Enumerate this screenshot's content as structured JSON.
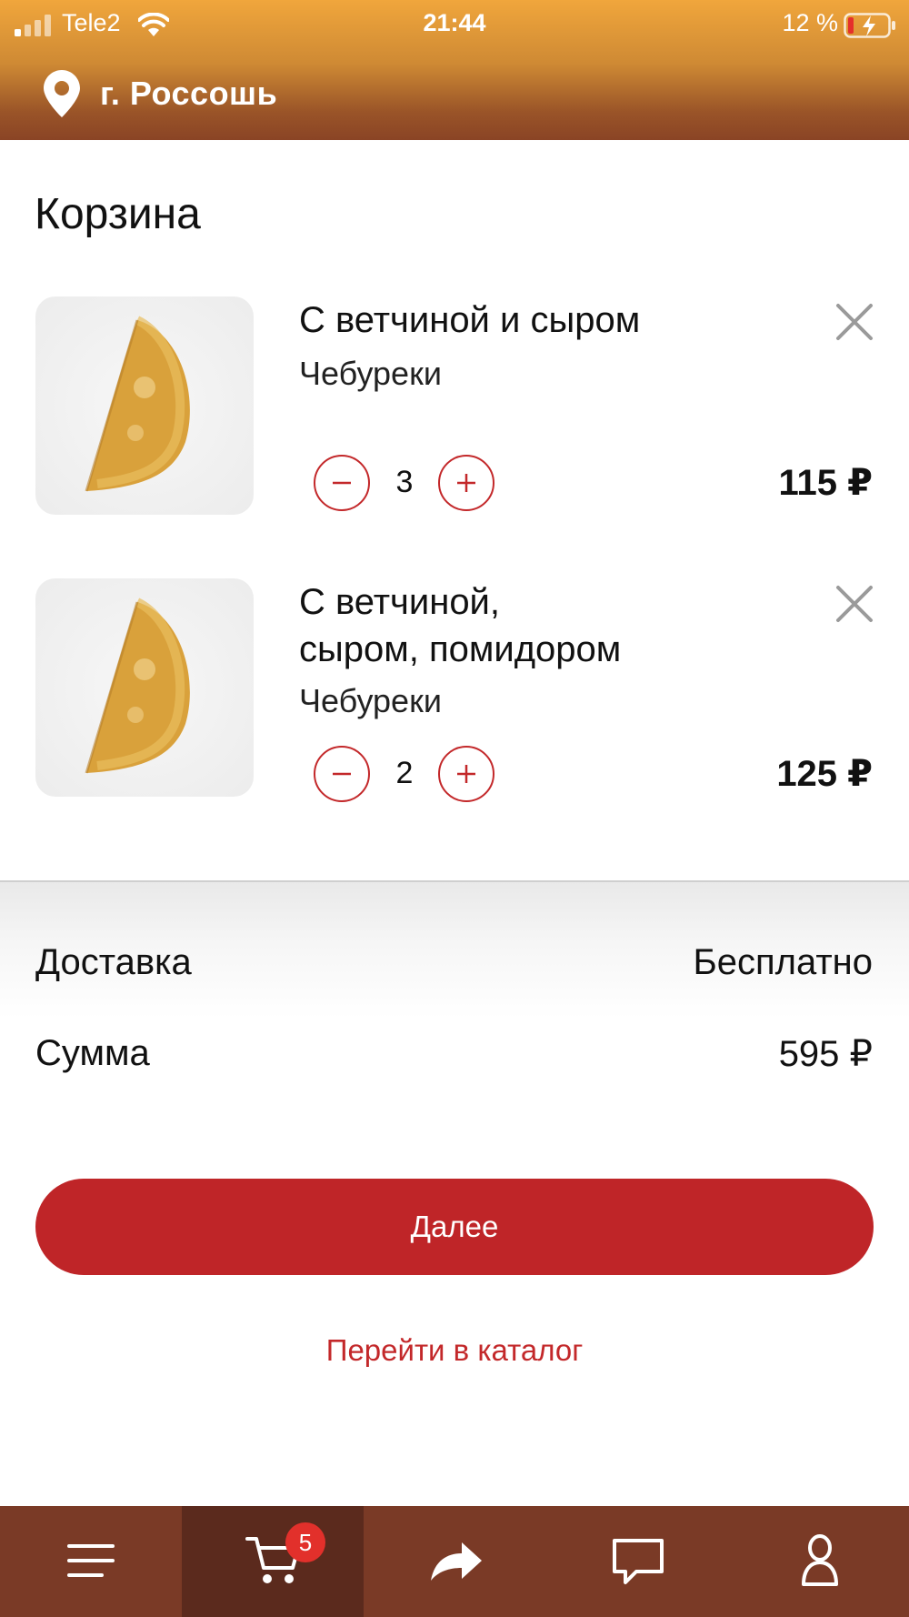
{
  "status_bar": {
    "carrier": "Tele2",
    "time": "21:44",
    "battery_percent": "12 %"
  },
  "header": {
    "city": "г. Россошь",
    "icon": "location-pin-icon"
  },
  "page": {
    "title": "Корзина"
  },
  "cart_items": [
    {
      "name": "С ветчиной и сыром",
      "category": "Чебуреки",
      "quantity": "3",
      "price": "115 ₽"
    },
    {
      "name_line1": "С ветчиной,",
      "name_line2": "сыром, помидором",
      "category": "Чебуреки",
      "quantity": "2",
      "price": "125 ₽"
    }
  ],
  "summary": {
    "delivery_label": "Доставка",
    "delivery_value": "Бесплатно",
    "total_label": "Сумма",
    "total_value": "595 ₽"
  },
  "actions": {
    "next_label": "Далее",
    "catalog_label": "Перейти в каталог"
  },
  "tab_bar": {
    "tabs": [
      {
        "icon": "menu-icon"
      },
      {
        "icon": "cart-icon",
        "active": true
      },
      {
        "icon": "share-icon"
      },
      {
        "icon": "chat-icon"
      },
      {
        "icon": "user-icon"
      }
    ],
    "cart_badge": "5"
  },
  "colors": {
    "accent": "#bf2528",
    "header_top": "#f0a63c",
    "header_bottom": "#8a4425",
    "tabbar": "#7a3a26",
    "tabbar_active": "#5b2a1d"
  }
}
